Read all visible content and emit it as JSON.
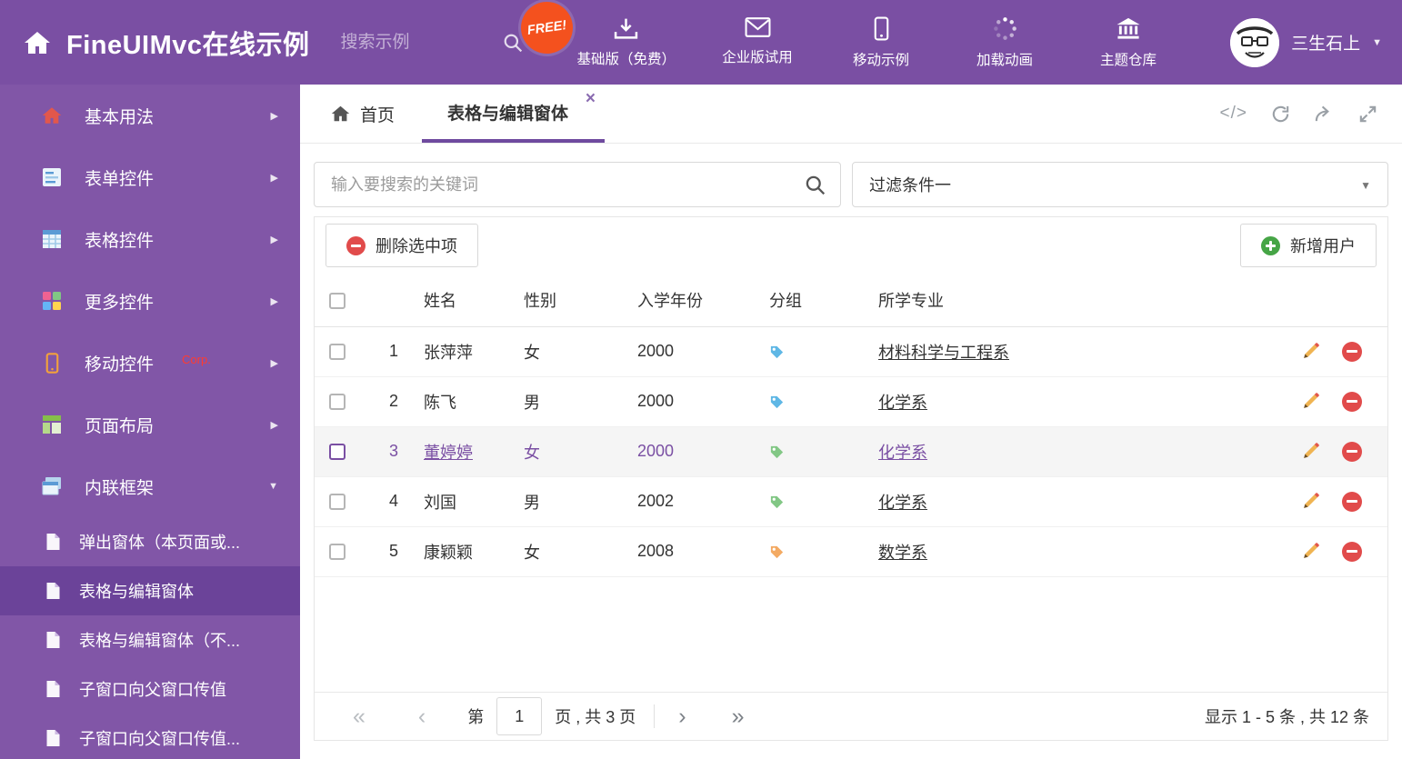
{
  "icons": {
    "chevron_right": "▶",
    "chevron_down": "▼",
    "caret_down": "▼",
    "close": "×",
    "code": "</>",
    "pg_first": "«",
    "pg_prev": "‹",
    "pg_next": "›",
    "pg_last": "»"
  },
  "colors": {
    "header_bg": "#7a4fa3",
    "sidebar_bg": "#8156a7",
    "sidebar_active_bg": "#6b4399",
    "accent": "#6f4a9f",
    "free_badge_bg": "#f4511e",
    "delete_red": "#e14b4b",
    "add_green": "#46a546"
  },
  "header": {
    "title": "FineUIMvc在线示例",
    "search_placeholder": "搜索示例",
    "free_badge": "FREE!",
    "nav": [
      {
        "label": "基础版（免费）"
      },
      {
        "label": "企业版试用"
      },
      {
        "label": "移动示例"
      },
      {
        "label": "加载动画"
      },
      {
        "label": "主题仓库"
      }
    ],
    "user_name": "三生石上"
  },
  "sidebar": {
    "items": [
      {
        "label": "基本用法"
      },
      {
        "label": "表单控件"
      },
      {
        "label": "表格控件"
      },
      {
        "label": "更多控件"
      },
      {
        "label": "移动控件",
        "badge": "Corp."
      },
      {
        "label": "页面布局"
      },
      {
        "label": "内联框架"
      }
    ],
    "subitems": [
      {
        "label": "弹出窗体（本页面或..."
      },
      {
        "label": "表格与编辑窗体"
      },
      {
        "label": "表格与编辑窗体（不..."
      },
      {
        "label": "子窗口向父窗口传值"
      },
      {
        "label": "子窗口向父窗口传值..."
      }
    ]
  },
  "tabs": {
    "home_label": "首页",
    "active_label": "表格与编辑窗体"
  },
  "filters": {
    "search_placeholder": "输入要搜索的关键词",
    "filter_value": "过滤条件一"
  },
  "toolbar": {
    "delete_label": "删除选中项",
    "add_label": "新增用户"
  },
  "table": {
    "headers": {
      "name": "姓名",
      "gender": "性别",
      "year": "入学年份",
      "group": "分组",
      "major": "所学专业"
    },
    "rows": [
      {
        "num": "1",
        "name": "张萍萍",
        "gender": "女",
        "year": "2000",
        "tag_color": "#5fb7e5",
        "major": "材料科学与工程系"
      },
      {
        "num": "2",
        "name": "陈飞",
        "gender": "男",
        "year": "2000",
        "tag_color": "#5fb7e5",
        "major": "化学系"
      },
      {
        "num": "3",
        "name": "董婷婷",
        "gender": "女",
        "year": "2000",
        "tag_color": "#82c785",
        "major": "化学系"
      },
      {
        "num": "4",
        "name": "刘国",
        "gender": "男",
        "year": "2002",
        "tag_color": "#82c785",
        "major": "化学系"
      },
      {
        "num": "5",
        "name": "康颖颖",
        "gender": "女",
        "year": "2008",
        "tag_color": "#f3aa63",
        "major": "数学系"
      }
    ]
  },
  "pagination": {
    "prefix": "第",
    "page_value": "1",
    "suffix": "页 , 共 3 页",
    "summary": "显示 1 - 5 条 , 共 12 条"
  }
}
